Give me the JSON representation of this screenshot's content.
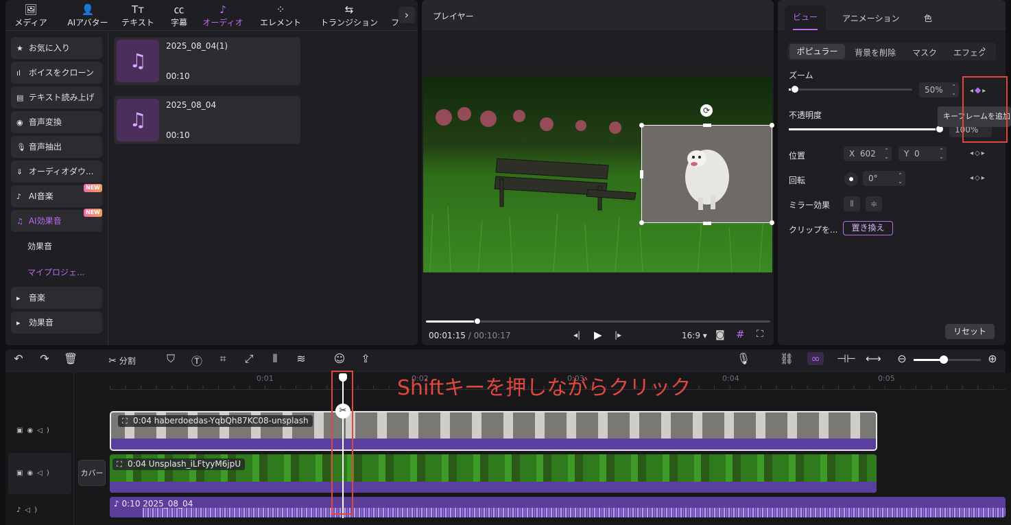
{
  "top_tabs": [
    {
      "label": "メディア",
      "icon": "media-icon",
      "glyph": "🖼"
    },
    {
      "label": "AIアバター",
      "icon": "avatar-icon",
      "glyph": "👤"
    },
    {
      "label": "テキスト",
      "icon": "text-icon",
      "glyph": "T"
    },
    {
      "label": "字幕",
      "icon": "caption-icon",
      "glyph": "㏄"
    },
    {
      "label": "オーディオ",
      "icon": "audio-icon",
      "glyph": "♪"
    },
    {
      "label": "エレメント",
      "icon": "element-icon",
      "glyph": "⁘"
    },
    {
      "label": "トランジション",
      "icon": "transition-icon",
      "glyph": "⇆"
    },
    {
      "label": "フ",
      "icon": "filter-icon",
      "glyph": ""
    }
  ],
  "left_menu": [
    {
      "label": "お気に入り",
      "glyph": "★"
    },
    {
      "label": "ボイスをクローン",
      "glyph": "♒"
    },
    {
      "label": "テキスト読み上げ",
      "glyph": "▤"
    },
    {
      "label": "音声変換",
      "glyph": "◉"
    },
    {
      "label": "音声抽出",
      "glyph": "🎙"
    },
    {
      "label": "オーディオダウ...",
      "glyph": "⇓"
    },
    {
      "label": "AI音楽",
      "glyph": "♪",
      "badge": "NEW"
    },
    {
      "label": "AI効果音",
      "glyph": "♫",
      "badge": "NEW"
    },
    {
      "label": "効果音",
      "glyph": ""
    },
    {
      "label": "マイプロジェ...",
      "glyph": ""
    },
    {
      "label": "音楽",
      "glyph": "▸"
    },
    {
      "label": "効果音",
      "glyph": "▸"
    }
  ],
  "audio_cards": [
    {
      "title": "2025_08_04(1)",
      "duration": "00:10"
    },
    {
      "title": "2025_08_04",
      "duration": "00:10"
    }
  ],
  "player": {
    "title": "プレイヤー",
    "current_time": "00:01:15",
    "separator": "/",
    "total_time": "00:10:17",
    "ratio": "16:9",
    "progress": 0.15
  },
  "right_tabs": [
    "ビュー",
    "アニメーション",
    "色"
  ],
  "sub_tabs": [
    "ポピュラー",
    "背景を削除",
    "マスク",
    "エフェク"
  ],
  "props": {
    "zoom_label": "ズーム",
    "zoom_value": "50%",
    "zoom_level": 0.05,
    "opacity_label": "不透明度",
    "opacity_value": "100%",
    "opacity_level": 1.0,
    "tooltip": "キーフレームを追加",
    "position_label": "位置",
    "x_label": "X",
    "x_value": "602",
    "y_label": "Y",
    "y_value": "0",
    "rotation_label": "回転",
    "rotation_value": "0°",
    "mirror_label": "ミラー効果",
    "clip_label": "クリップを...",
    "replace_label": "置き換え",
    "reset_label": "リセット"
  },
  "toolbar": {
    "split_label": "分割"
  },
  "timeline": {
    "ticks": [
      "0:01",
      "0:02",
      "0:03",
      "0:04",
      "0:05"
    ],
    "annotation": "Shiftキーを押しながらクリック",
    "clip1": "0:04 haberdoedas-YqbQh87KC08-unsplash",
    "clip2": "0:04 Unsplash_iLFtyyM6jpU",
    "audio_clip": "0:10 2025_08_04",
    "cover_label": "カバー"
  },
  "colors": {
    "accent": "#b86cf0",
    "annotation": "#e0473d",
    "clip_bar": "#5b3fa0",
    "audio": "#6a4bb0"
  }
}
